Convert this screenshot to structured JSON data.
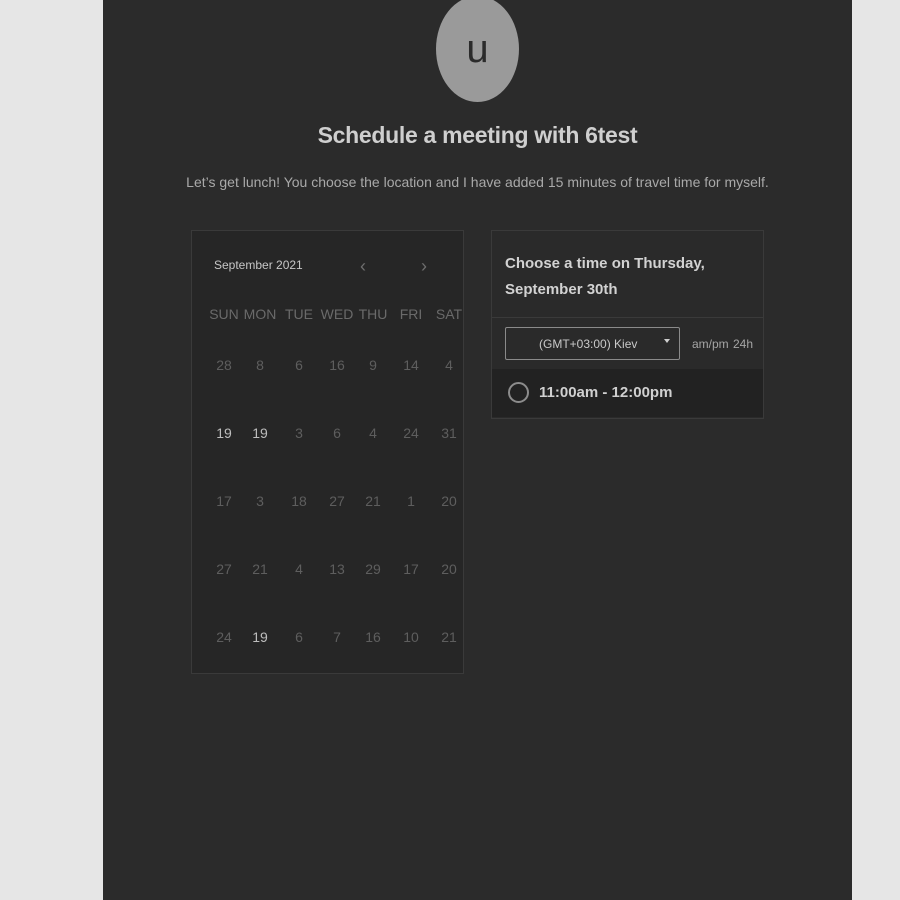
{
  "header": {
    "avatar_letter": "u",
    "title": "Schedule a meeting with 6test",
    "subtitle": "Let’s get lunch! You choose the location and I have added 15 minutes of travel time for myself."
  },
  "calendar": {
    "month_label": "September 2021",
    "prev_icon": "‹",
    "next_icon": "›",
    "weekdays": [
      "SUN",
      "MON",
      "TUE",
      "WED",
      "THU",
      "FRI",
      "SAT"
    ],
    "weeks": [
      [
        {
          "d": "28",
          "available": false
        },
        {
          "d": "8",
          "available": false
        },
        {
          "d": "6",
          "available": false
        },
        {
          "d": "16",
          "available": false
        },
        {
          "d": "9",
          "available": false
        },
        {
          "d": "14",
          "available": false
        },
        {
          "d": "4",
          "available": false
        }
      ],
      [
        {
          "d": "19",
          "available": true
        },
        {
          "d": "19",
          "available": true
        },
        {
          "d": "3",
          "available": false
        },
        {
          "d": "6",
          "available": false
        },
        {
          "d": "4",
          "available": false
        },
        {
          "d": "24",
          "available": false
        },
        {
          "d": "31",
          "available": false
        }
      ],
      [
        {
          "d": "17",
          "available": false
        },
        {
          "d": "3",
          "available": false
        },
        {
          "d": "18",
          "available": false
        },
        {
          "d": "27",
          "available": false
        },
        {
          "d": "21",
          "available": false
        },
        {
          "d": "1",
          "available": false
        },
        {
          "d": "20",
          "available": false
        }
      ],
      [
        {
          "d": "27",
          "available": false
        },
        {
          "d": "21",
          "available": false
        },
        {
          "d": "4",
          "available": false
        },
        {
          "d": "13",
          "available": false
        },
        {
          "d": "29",
          "available": false
        },
        {
          "d": "17",
          "available": false
        },
        {
          "d": "20",
          "available": false
        }
      ],
      [
        {
          "d": "24",
          "available": false
        },
        {
          "d": "19",
          "available": true
        },
        {
          "d": "6",
          "available": false
        },
        {
          "d": "7",
          "available": false
        },
        {
          "d": "16",
          "available": false
        },
        {
          "d": "10",
          "available": false
        },
        {
          "d": "21",
          "available": false
        }
      ]
    ]
  },
  "time_panel": {
    "title": "Choose a time on Thursday, September 30th",
    "timezone": "(GMT+03:00) Kiev",
    "format_ampm": "am/pm",
    "format_24h": "24h",
    "slots": [
      "11:00am - 12:00pm"
    ]
  },
  "colors": {
    "background": "#2b2b2b",
    "outer": "#e6e6e6",
    "avatar": "#9a9a9a"
  }
}
